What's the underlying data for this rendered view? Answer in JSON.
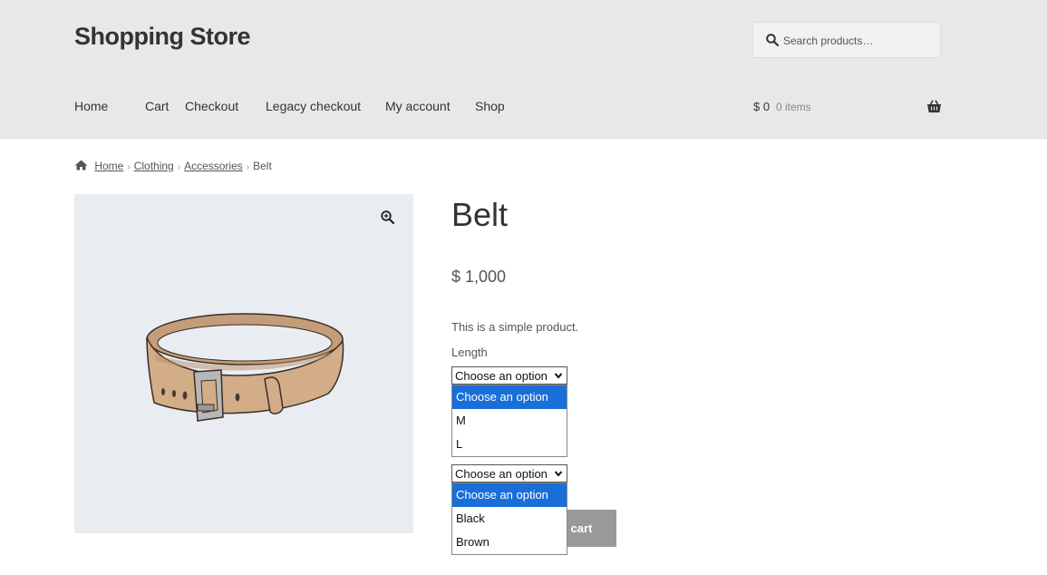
{
  "header": {
    "site_title": "Shopping Store",
    "search_placeholder": "Search products…",
    "nav": [
      "Home",
      "Cart",
      "Checkout",
      "Legacy checkout",
      "My account",
      "Shop"
    ],
    "cart_total": "$ 0",
    "cart_count": "0 items"
  },
  "breadcrumb": {
    "items": [
      "Home",
      "Clothing",
      "Accessories"
    ],
    "current": "Belt"
  },
  "product": {
    "title": "Belt",
    "price": "$ 1,000",
    "description": "This is a simple product.",
    "length_label": "Length",
    "length_select": {
      "value": "Choose an option",
      "options": [
        "Choose an option",
        "M",
        "L"
      ]
    },
    "color_select": {
      "value": "Choose an option",
      "options": [
        "Choose an option",
        "Black",
        "Brown"
      ]
    },
    "add_to_cart_visible": "o cart"
  },
  "icons": [
    "search-icon",
    "basket-icon",
    "home-icon",
    "zoom-icon",
    "chevron-down-icon"
  ],
  "colors": {
    "header_bg": "#e8e8e8",
    "selected_option": "#1a6ed8",
    "button": "#999999",
    "gallery_bg": "#e9edf2"
  }
}
